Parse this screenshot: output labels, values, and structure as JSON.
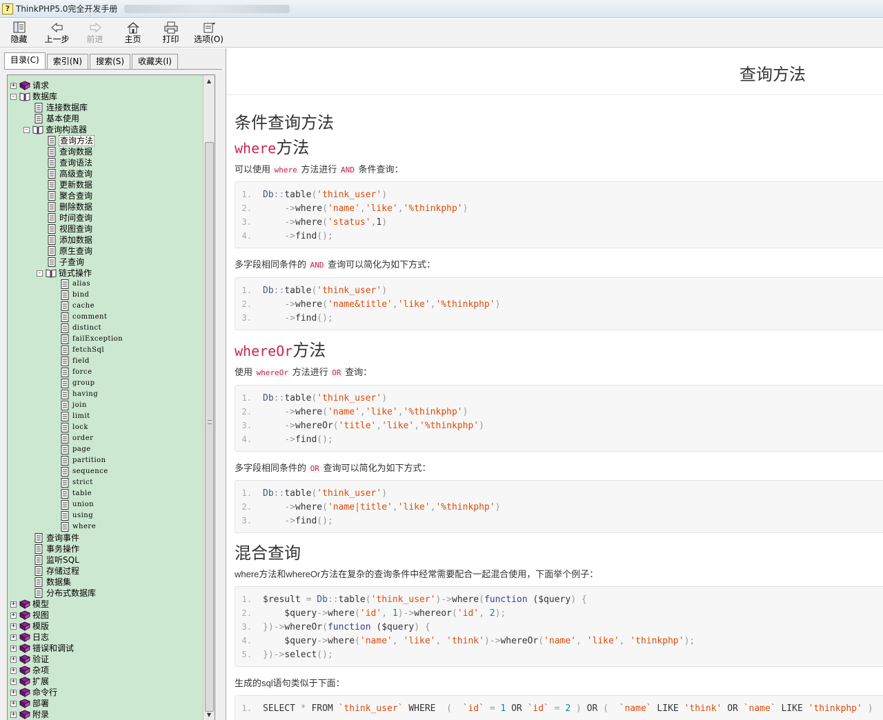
{
  "window": {
    "title": "ThinkPHP5.0完全开发手册"
  },
  "toolbar": {
    "buttons": [
      {
        "id": "hide",
        "label": "隐藏",
        "icon": "hide-icon",
        "enabled": true
      },
      {
        "id": "back",
        "label": "上一步",
        "icon": "back-arrow-icon",
        "enabled": true
      },
      {
        "id": "forward",
        "label": "前进",
        "icon": "forward-arrow-icon",
        "enabled": false
      },
      {
        "id": "home",
        "label": "主页",
        "icon": "home-icon",
        "enabled": true
      },
      {
        "id": "print",
        "label": "打印",
        "icon": "printer-icon",
        "enabled": true
      },
      {
        "id": "options",
        "label": "选项(O)",
        "icon": "options-icon",
        "enabled": true
      }
    ]
  },
  "sidebar": {
    "tabs": [
      {
        "label": "目录(C)",
        "active": true
      },
      {
        "label": "索引(N)",
        "active": false
      },
      {
        "label": "搜索(S)",
        "active": false
      },
      {
        "label": "收藏夹(I)",
        "active": false
      }
    ],
    "tree": [
      {
        "label": "请求",
        "level": 0,
        "type": "book",
        "expander": "+"
      },
      {
        "label": "数据库",
        "level": 0,
        "type": "book-open",
        "expander": "-"
      },
      {
        "label": "连接数据库",
        "level": 1,
        "type": "page"
      },
      {
        "label": "基本使用",
        "level": 1,
        "type": "page"
      },
      {
        "label": "查询构造器",
        "level": 1,
        "type": "book-open",
        "expander": "-"
      },
      {
        "label": "查询方法",
        "level": 2,
        "type": "page",
        "selected": true
      },
      {
        "label": "查询数据",
        "level": 2,
        "type": "page"
      },
      {
        "label": "查询语法",
        "level": 2,
        "type": "page"
      },
      {
        "label": "高级查询",
        "level": 2,
        "type": "page"
      },
      {
        "label": "更新数据",
        "level": 2,
        "type": "page"
      },
      {
        "label": "聚合查询",
        "level": 2,
        "type": "page"
      },
      {
        "label": "删除数据",
        "level": 2,
        "type": "page"
      },
      {
        "label": "时间查询",
        "level": 2,
        "type": "page"
      },
      {
        "label": "视图查询",
        "level": 2,
        "type": "page"
      },
      {
        "label": "添加数据",
        "level": 2,
        "type": "page"
      },
      {
        "label": "原生查询",
        "level": 2,
        "type": "page"
      },
      {
        "label": "子查询",
        "level": 2,
        "type": "page"
      },
      {
        "label": "链式操作",
        "level": 2,
        "type": "book-open",
        "expander": "-"
      },
      {
        "label": "alias",
        "level": 3,
        "type": "page",
        "mono": true
      },
      {
        "label": "bind",
        "level": 3,
        "type": "page",
        "mono": true
      },
      {
        "label": "cache",
        "level": 3,
        "type": "page",
        "mono": true
      },
      {
        "label": "comment",
        "level": 3,
        "type": "page",
        "mono": true
      },
      {
        "label": "distinct",
        "level": 3,
        "type": "page",
        "mono": true
      },
      {
        "label": "failException",
        "level": 3,
        "type": "page",
        "mono": true
      },
      {
        "label": "fetchSql",
        "level": 3,
        "type": "page",
        "mono": true
      },
      {
        "label": "field",
        "level": 3,
        "type": "page",
        "mono": true
      },
      {
        "label": "force",
        "level": 3,
        "type": "page",
        "mono": true
      },
      {
        "label": "group",
        "level": 3,
        "type": "page",
        "mono": true
      },
      {
        "label": "having",
        "level": 3,
        "type": "page",
        "mono": true
      },
      {
        "label": "join",
        "level": 3,
        "type": "page",
        "mono": true
      },
      {
        "label": "limit",
        "level": 3,
        "type": "page",
        "mono": true
      },
      {
        "label": "lock",
        "level": 3,
        "type": "page",
        "mono": true
      },
      {
        "label": "order",
        "level": 3,
        "type": "page",
        "mono": true
      },
      {
        "label": "page",
        "level": 3,
        "type": "page",
        "mono": true
      },
      {
        "label": "partition",
        "level": 3,
        "type": "page",
        "mono": true
      },
      {
        "label": "sequence",
        "level": 3,
        "type": "page",
        "mono": true
      },
      {
        "label": "strict",
        "level": 3,
        "type": "page",
        "mono": true
      },
      {
        "label": "table",
        "level": 3,
        "type": "page",
        "mono": true
      },
      {
        "label": "union",
        "level": 3,
        "type": "page",
        "mono": true
      },
      {
        "label": "using",
        "level": 3,
        "type": "page",
        "mono": true
      },
      {
        "label": "where",
        "level": 3,
        "type": "page",
        "mono": true
      },
      {
        "label": "查询事件",
        "level": 1,
        "type": "page"
      },
      {
        "label": "事务操作",
        "level": 1,
        "type": "page"
      },
      {
        "label": "监听SQL",
        "level": 1,
        "type": "page"
      },
      {
        "label": "存储过程",
        "level": 1,
        "type": "page"
      },
      {
        "label": "数据集",
        "level": 1,
        "type": "page"
      },
      {
        "label": "分布式数据库",
        "level": 1,
        "type": "page"
      },
      {
        "label": "模型",
        "level": 0,
        "type": "book",
        "expander": "+"
      },
      {
        "label": "视图",
        "level": 0,
        "type": "book",
        "expander": "+"
      },
      {
        "label": "模版",
        "level": 0,
        "type": "book",
        "expander": "+"
      },
      {
        "label": "日志",
        "level": 0,
        "type": "book",
        "expander": "+"
      },
      {
        "label": "错误和调试",
        "level": 0,
        "type": "book",
        "expander": "+"
      },
      {
        "label": "验证",
        "level": 0,
        "type": "book",
        "expander": "+"
      },
      {
        "label": "杂项",
        "level": 0,
        "type": "book",
        "expander": "+"
      },
      {
        "label": "扩展",
        "level": 0,
        "type": "book",
        "expander": "+"
      },
      {
        "label": "命令行",
        "level": 0,
        "type": "book",
        "expander": "+"
      },
      {
        "label": "部署",
        "level": 0,
        "type": "book",
        "expander": "+"
      },
      {
        "label": "附录",
        "level": 0,
        "type": "book",
        "expander": "+"
      }
    ]
  },
  "content": {
    "page_title": "查询方法",
    "section1_title": "条件查询方法",
    "where_heading": {
      "code": "where",
      "text": "方法"
    },
    "p1": {
      "a": "可以使用",
      "code1": "where",
      "b": "方法进行",
      "code2": "AND",
      "c": "条件查询："
    },
    "code1": [
      [
        [
          "cls",
          "Db"
        ],
        [
          "op",
          "::"
        ],
        [
          "fn",
          "table"
        ],
        [
          "op",
          "("
        ],
        [
          "str",
          "'think_user'"
        ],
        [
          "op",
          ")"
        ]
      ],
      [
        [
          "plain",
          "    "
        ],
        [
          "op",
          "->"
        ],
        [
          "fn",
          "where"
        ],
        [
          "op",
          "("
        ],
        [
          "str",
          "'name'"
        ],
        [
          "op",
          ","
        ],
        [
          "str",
          "'like'"
        ],
        [
          "op",
          ","
        ],
        [
          "str",
          "'%thinkphp'"
        ],
        [
          "op",
          ")"
        ]
      ],
      [
        [
          "plain",
          "    "
        ],
        [
          "op",
          "->"
        ],
        [
          "fn",
          "where"
        ],
        [
          "op",
          "("
        ],
        [
          "str",
          "'status'"
        ],
        [
          "op",
          ","
        ],
        [
          "plain",
          "1"
        ],
        [
          "op",
          ")"
        ]
      ],
      [
        [
          "plain",
          "    "
        ],
        [
          "op",
          "->"
        ],
        [
          "fn",
          "find"
        ],
        [
          "op",
          "();"
        ]
      ]
    ],
    "p2": {
      "a": "多字段相同条件的",
      "code1": "AND",
      "b": "查询可以简化为如下方式："
    },
    "code2": [
      [
        [
          "cls",
          "Db"
        ],
        [
          "op",
          "::"
        ],
        [
          "fn",
          "table"
        ],
        [
          "op",
          "("
        ],
        [
          "str",
          "'think_user'"
        ],
        [
          "op",
          ")"
        ]
      ],
      [
        [
          "plain",
          "    "
        ],
        [
          "op",
          "->"
        ],
        [
          "fn",
          "where"
        ],
        [
          "op",
          "("
        ],
        [
          "str",
          "'name&title'"
        ],
        [
          "op",
          ","
        ],
        [
          "str",
          "'like'"
        ],
        [
          "op",
          ","
        ],
        [
          "str",
          "'%thinkphp'"
        ],
        [
          "op",
          ")"
        ]
      ],
      [
        [
          "plain",
          "    "
        ],
        [
          "op",
          "->"
        ],
        [
          "fn",
          "find"
        ],
        [
          "op",
          "();"
        ]
      ]
    ],
    "whereor_heading": {
      "code": "whereOr",
      "text": "方法"
    },
    "p3": {
      "a": "使用",
      "code1": "whereOr",
      "b": "方法进行",
      "code2": "OR",
      "c": "查询："
    },
    "code3": [
      [
        [
          "cls",
          "Db"
        ],
        [
          "op",
          "::"
        ],
        [
          "fn",
          "table"
        ],
        [
          "op",
          "("
        ],
        [
          "str",
          "'think_user'"
        ],
        [
          "op",
          ")"
        ]
      ],
      [
        [
          "plain",
          "    "
        ],
        [
          "op",
          "->"
        ],
        [
          "fn",
          "where"
        ],
        [
          "op",
          "("
        ],
        [
          "str",
          "'name'"
        ],
        [
          "op",
          ","
        ],
        [
          "str",
          "'like'"
        ],
        [
          "op",
          ","
        ],
        [
          "str",
          "'%thinkphp'"
        ],
        [
          "op",
          ")"
        ]
      ],
      [
        [
          "plain",
          "    "
        ],
        [
          "op",
          "->"
        ],
        [
          "fn",
          "whereOr"
        ],
        [
          "op",
          "("
        ],
        [
          "str",
          "'title'"
        ],
        [
          "op",
          ","
        ],
        [
          "str",
          "'like'"
        ],
        [
          "op",
          ","
        ],
        [
          "str",
          "'%thinkphp'"
        ],
        [
          "op",
          ")"
        ]
      ],
      [
        [
          "plain",
          "    "
        ],
        [
          "op",
          "->"
        ],
        [
          "fn",
          "find"
        ],
        [
          "op",
          "();"
        ]
      ]
    ],
    "p4": {
      "a": "多字段相同条件的",
      "code1": "OR",
      "b": "查询可以简化为如下方式："
    },
    "code4": [
      [
        [
          "cls",
          "Db"
        ],
        [
          "op",
          "::"
        ],
        [
          "fn",
          "table"
        ],
        [
          "op",
          "("
        ],
        [
          "str",
          "'think_user'"
        ],
        [
          "op",
          ")"
        ]
      ],
      [
        [
          "plain",
          "    "
        ],
        [
          "op",
          "->"
        ],
        [
          "fn",
          "where"
        ],
        [
          "op",
          "("
        ],
        [
          "str",
          "'name|title'"
        ],
        [
          "op",
          ","
        ],
        [
          "str",
          "'like'"
        ],
        [
          "op",
          ","
        ],
        [
          "str",
          "'%thinkphp'"
        ],
        [
          "op",
          ")"
        ]
      ],
      [
        [
          "plain",
          "    "
        ],
        [
          "op",
          "->"
        ],
        [
          "fn",
          "find"
        ],
        [
          "op",
          "();"
        ]
      ]
    ],
    "section2_title": "混合查询",
    "p5": "where方法和whereOr方法在复杂的查询条件中经常需要配合一起混合使用，下面举个例子：",
    "code5": [
      [
        [
          "plain",
          "$result "
        ],
        [
          "op",
          "= "
        ],
        [
          "cls",
          "Db"
        ],
        [
          "op",
          "::"
        ],
        [
          "fn",
          "table"
        ],
        [
          "op",
          "("
        ],
        [
          "str",
          "'think_user'"
        ],
        [
          "op",
          ")->"
        ],
        [
          "fn",
          "where"
        ],
        [
          "op",
          "("
        ],
        [
          "kw",
          "function"
        ],
        [
          "plain",
          " ($query"
        ],
        [
          "op",
          ") {"
        ]
      ],
      [
        [
          "plain",
          "    $query"
        ],
        [
          "op",
          "->"
        ],
        [
          "fn",
          "where"
        ],
        [
          "op",
          "("
        ],
        [
          "str",
          "'id'"
        ],
        [
          "op",
          ", "
        ],
        [
          "num",
          "1"
        ],
        [
          "op",
          ")->"
        ],
        [
          "fn",
          "whereor"
        ],
        [
          "op",
          "("
        ],
        [
          "str",
          "'id'"
        ],
        [
          "op",
          ", "
        ],
        [
          "num",
          "2"
        ],
        [
          "op",
          ");"
        ]
      ],
      [
        [
          "op",
          "})->"
        ],
        [
          "fn",
          "whereOr"
        ],
        [
          "op",
          "("
        ],
        [
          "kw",
          "function"
        ],
        [
          "plain",
          " ($query"
        ],
        [
          "op",
          ") {"
        ]
      ],
      [
        [
          "plain",
          "    $query"
        ],
        [
          "op",
          "->"
        ],
        [
          "fn",
          "where"
        ],
        [
          "op",
          "("
        ],
        [
          "str",
          "'name'"
        ],
        [
          "op",
          ", "
        ],
        [
          "str",
          "'like'"
        ],
        [
          "op",
          ", "
        ],
        [
          "str",
          "'think'"
        ],
        [
          "op",
          ")->"
        ],
        [
          "fn",
          "whereOr"
        ],
        [
          "op",
          "("
        ],
        [
          "str",
          "'name'"
        ],
        [
          "op",
          ", "
        ],
        [
          "str",
          "'like'"
        ],
        [
          "op",
          ", "
        ],
        [
          "str",
          "'thinkphp'"
        ],
        [
          "op",
          ");"
        ]
      ],
      [
        [
          "op",
          "})->"
        ],
        [
          "fn",
          "select"
        ],
        [
          "op",
          "();"
        ]
      ]
    ],
    "p6": "生成的sql语句类似于下面：",
    "code6": [
      [
        [
          "plain",
          "SELECT "
        ],
        [
          "op",
          "* "
        ],
        [
          "plain",
          "FROM "
        ],
        [
          "str",
          "`think_user`"
        ],
        [
          "plain",
          " WHERE  "
        ],
        [
          "op",
          "(  "
        ],
        [
          "str",
          "`id`"
        ],
        [
          "op",
          " = "
        ],
        [
          "num",
          "1"
        ],
        [
          "plain",
          " OR "
        ],
        [
          "str",
          "`id`"
        ],
        [
          "op",
          " = "
        ],
        [
          "num",
          "2"
        ],
        [
          "op",
          " ) "
        ],
        [
          "plain",
          "OR "
        ],
        [
          "op",
          "(  "
        ],
        [
          "str",
          "`name`"
        ],
        [
          "plain",
          " LIKE "
        ],
        [
          "str",
          "'think'"
        ],
        [
          "plain",
          " OR "
        ],
        [
          "str",
          "`name`"
        ],
        [
          "plain",
          " LIKE "
        ],
        [
          "str",
          "'thinkphp'"
        ],
        [
          "op",
          " )"
        ]
      ]
    ]
  }
}
